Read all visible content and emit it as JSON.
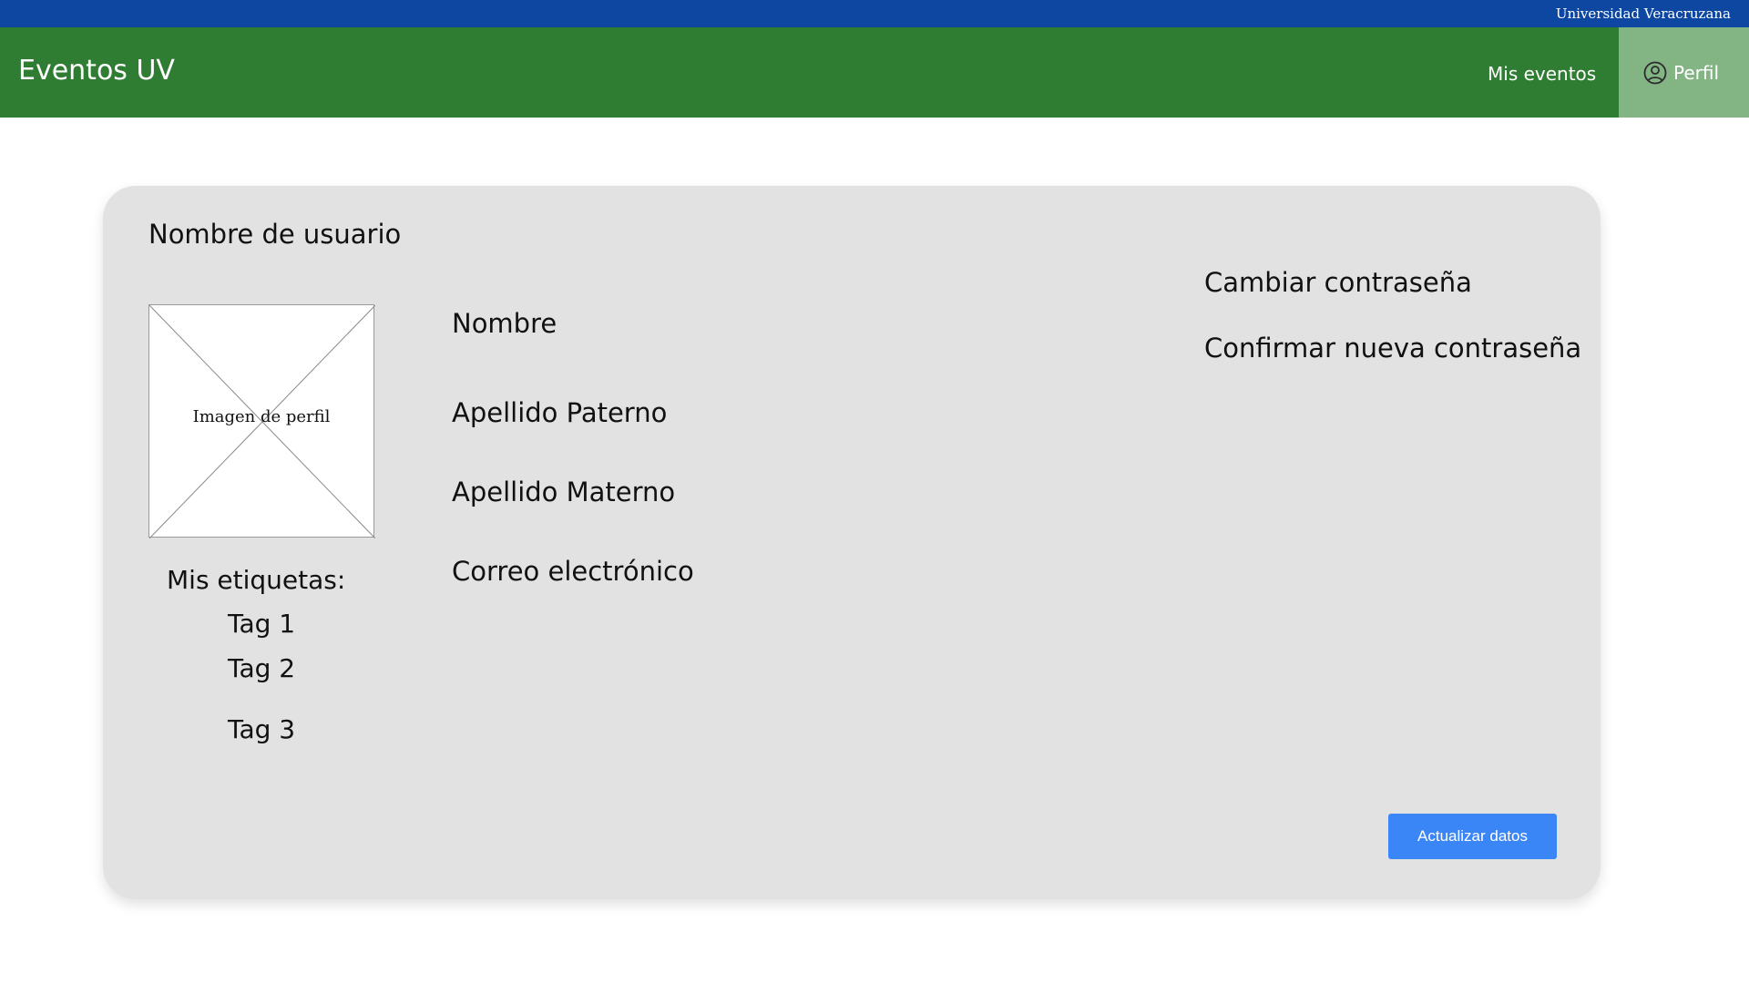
{
  "header": {
    "institution": "Universidad Veracruzana",
    "brand": "Eventos UV",
    "nav": {
      "my_events": "Mis eventos",
      "profile": "Perfil"
    },
    "colors": {
      "top_bar": "#0e47a1",
      "nav_bar": "#2e7d32",
      "active_tab": "#82b484"
    }
  },
  "profile_card": {
    "username_label": "Nombre de usuario",
    "avatar_placeholder": "Imagen de perfil",
    "tags_heading": "Mis etiquetas:",
    "tags": [
      "Tag 1",
      "Tag 2",
      "Tag 3"
    ],
    "fields": {
      "first_name": "Nombre",
      "paternal_surname": "Apellido Paterno",
      "maternal_surname": "Apellido Materno",
      "email": "Correo electrónico"
    },
    "password": {
      "change": "Cambiar  contraseña",
      "confirm": "Confirmar nueva contraseña"
    },
    "update_button": "Actualizar datos",
    "colors": {
      "card_background": "#e2e2e2",
      "button": "#3b86f7"
    }
  }
}
